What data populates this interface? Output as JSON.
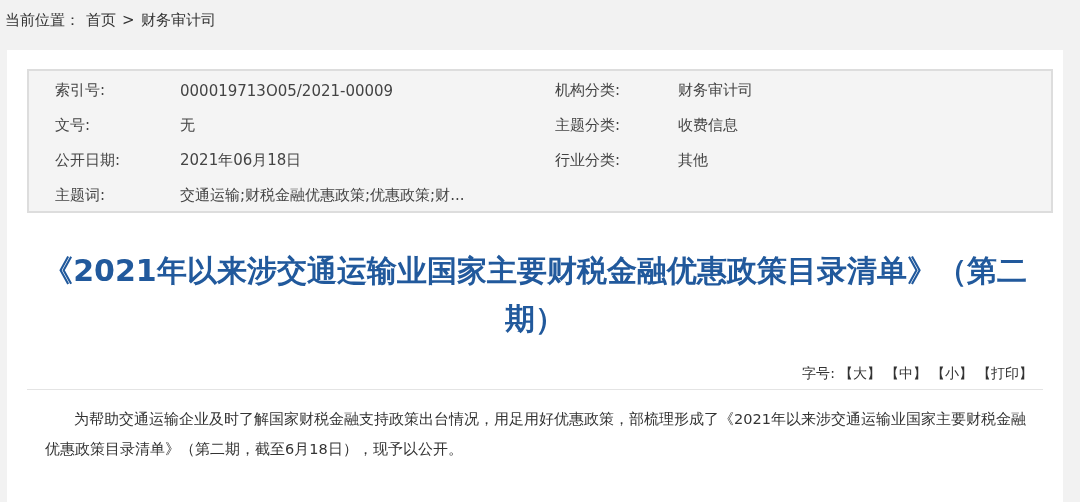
{
  "breadcrumb": {
    "label": "当前位置：",
    "items": [
      "首页",
      "财务审计司"
    ],
    "separator": ">"
  },
  "meta": [
    {
      "label": "索引号:",
      "value": "000019713O05/2021-00009"
    },
    {
      "label": "机构分类:",
      "value": "财务审计司"
    },
    {
      "label": "文号:",
      "value": "无"
    },
    {
      "label": "主题分类:",
      "value": "收费信息"
    },
    {
      "label": "公开日期:",
      "value": "2021年06月18日"
    },
    {
      "label": "行业分类:",
      "value": "其他"
    },
    {
      "label": "主题词:",
      "value": "交通运输;财税金融优惠政策;优惠政策;财..."
    }
  ],
  "title": "《2021年以来涉交通运输业国家主要财税金融优惠政策目录清单》（第二期）",
  "font_size_bar": {
    "label": "字号:",
    "options": [
      "【大】",
      "【中】",
      "【小】",
      "【打印】"
    ]
  },
  "body": "为帮助交通运输企业及时了解国家财税金融支持政策出台情况，用足用好优惠政策，部梳理形成了《2021年以来涉交通运输业国家主要财税金融优惠政策目录清单》（第二期，截至6月18日），现予以公开。"
}
